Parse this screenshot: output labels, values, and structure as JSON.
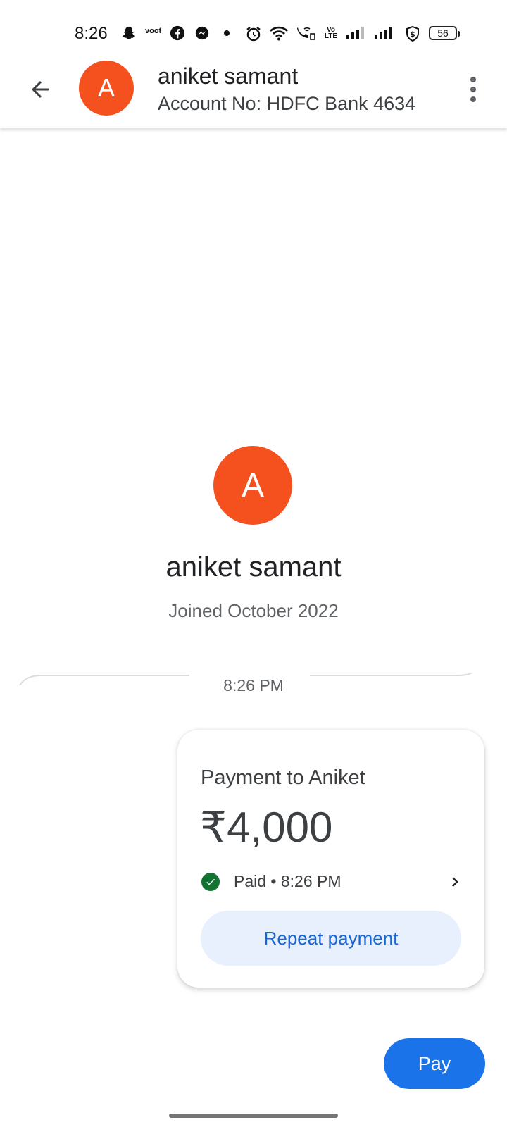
{
  "status_bar": {
    "time": "8:26",
    "app_icons": [
      "snapchat-icon",
      "voot-icon",
      "facebook-icon",
      "messenger-icon"
    ],
    "voot_text": "voot",
    "volte_text": "Vo LTE",
    "battery": "56"
  },
  "header": {
    "avatar_letter": "A",
    "name": "aniket samant",
    "account": "Account No: HDFC Bank 4634"
  },
  "profile": {
    "avatar_letter": "A",
    "name": "aniket samant",
    "joined": "Joined October 2022"
  },
  "timeline": {
    "timestamp": "8:26 PM"
  },
  "payment_card": {
    "title": "Payment to Aniket",
    "amount": "₹4,000",
    "status": "Paid • 8:26 PM",
    "repeat_label": "Repeat payment"
  },
  "fab": {
    "pay_label": "Pay"
  },
  "colors": {
    "avatar": "#f4511e",
    "primary": "#1a73e8",
    "paid": "#137333",
    "repeat_bg": "#e8f0fe"
  }
}
